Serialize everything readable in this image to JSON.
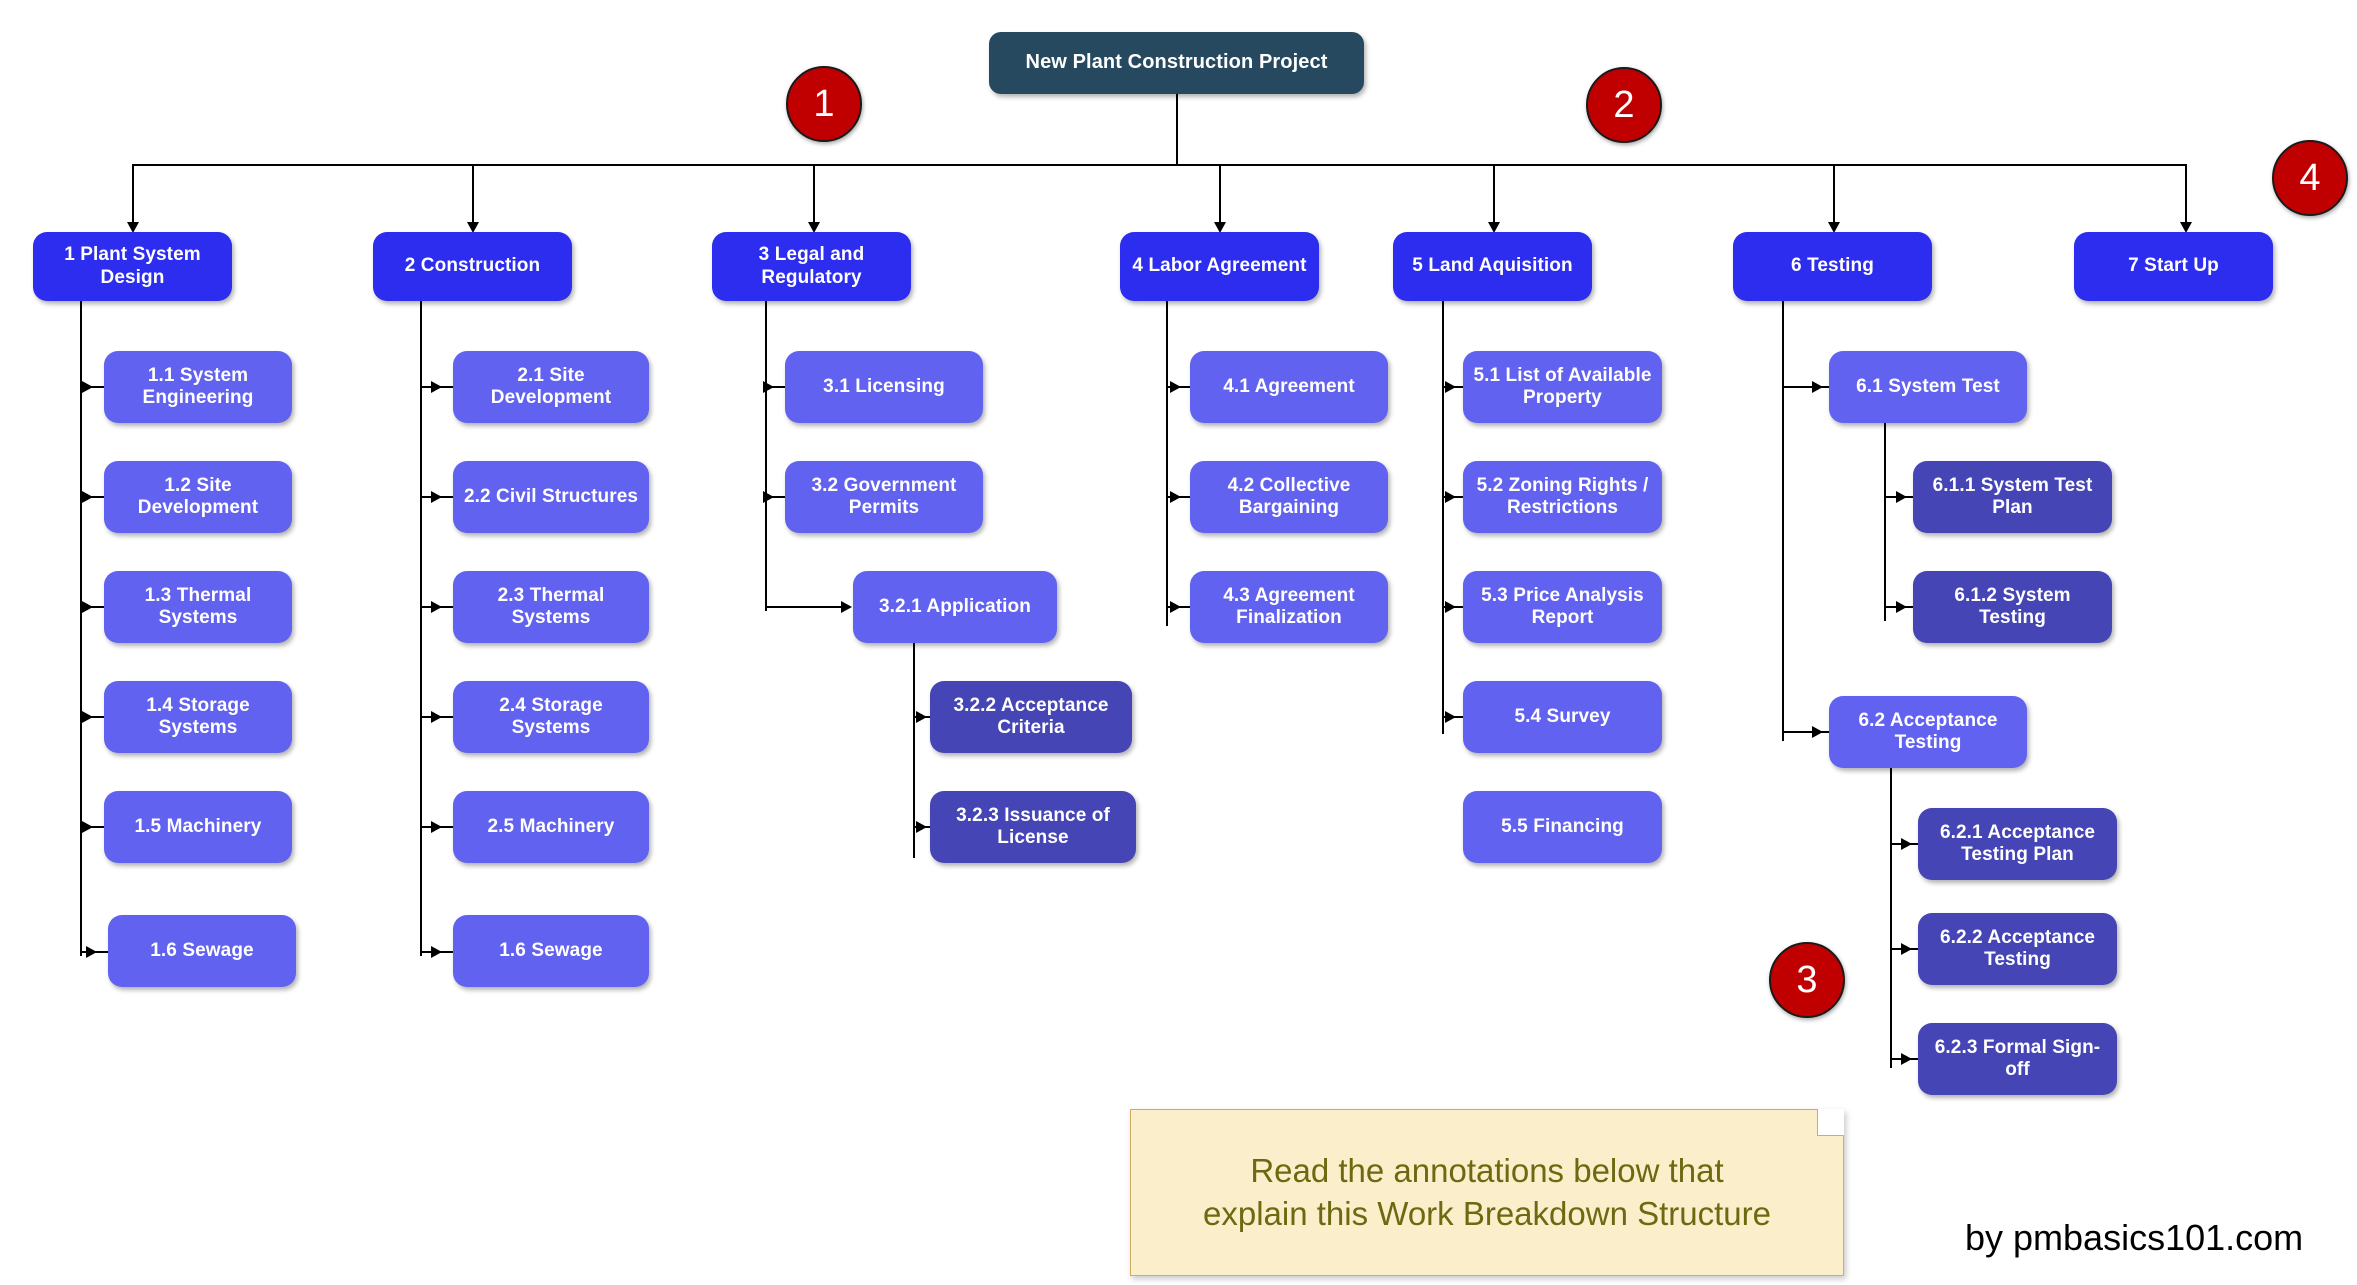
{
  "diagram": {
    "title": "Work Breakdown Structure",
    "root": {
      "label": "New Plant Construction Project"
    },
    "colors": {
      "root": "#26495f",
      "level1": "#2d2df0",
      "level2": "#6262f0",
      "level3": "#4545b5",
      "badge": "#c00000",
      "note_bg": "#fbeecb",
      "note_text": "#6b6a10",
      "connector": "#000000"
    },
    "columns": [
      {
        "id": "c1",
        "parent": {
          "label": "1  Plant System Design"
        },
        "children": [
          {
            "label": "1.1  System Engineering"
          },
          {
            "label": "1.2  Site Development"
          },
          {
            "label": "1.3  Thermal Systems"
          },
          {
            "label": "1.4  Storage Systems"
          },
          {
            "label": "1.5  Machinery"
          },
          {
            "label": "1.6  Sewage"
          }
        ]
      },
      {
        "id": "c2",
        "parent": {
          "label": "2  Construction"
        },
        "children": [
          {
            "label": "2.1  Site Development"
          },
          {
            "label": "2.2  Civil Structures"
          },
          {
            "label": "2.3  Thermal Systems"
          },
          {
            "label": "2.4  Storage Systems"
          },
          {
            "label": "2.5  Machinery"
          },
          {
            "label": "1.6 Sewage"
          }
        ]
      },
      {
        "id": "c3",
        "parent": {
          "label": "3  Legal and Regulatory"
        },
        "children": [
          {
            "label": "3.1  Licensing"
          },
          {
            "label": "3.2  Government Permits"
          },
          {
            "label": "3.2.1  Application"
          }
        ],
        "grandchildren": [
          {
            "label": "3.2.2  Acceptance Criteria"
          },
          {
            "label": "3.2.3  Issuance of License"
          }
        ]
      },
      {
        "id": "c4",
        "parent": {
          "label": "4  Labor Agreement"
        },
        "children": [
          {
            "label": "4.1  Agreement"
          },
          {
            "label": "4.2  Collective Bargaining"
          },
          {
            "label": "4.3  Agreement Finalization"
          }
        ]
      },
      {
        "id": "c5",
        "parent": {
          "label": "5  Land Aquisition"
        },
        "children": [
          {
            "label": "5.1  List of Available Property"
          },
          {
            "label": "5.2  Zoning Rights / Restrictions"
          },
          {
            "label": "5.3  Price Analysis Report"
          },
          {
            "label": "5.4  Survey"
          },
          {
            "label": "5.5  Financing"
          }
        ]
      },
      {
        "id": "c6",
        "parent": {
          "label": "6  Testing"
        },
        "children": [
          {
            "label": "6.1  System Test"
          },
          {
            "label": "6.2 Acceptance Testing"
          }
        ],
        "grandchildren_a": [
          {
            "label": "6.1.1 System Test Plan"
          },
          {
            "label": "6.1.2  System Testing"
          }
        ],
        "grandchildren_b": [
          {
            "label": "6.2.1 Acceptance Testing Plan"
          },
          {
            "label": "6.2.2 Acceptance Testing"
          },
          {
            "label": "6.2.3 Formal Sign-off"
          }
        ]
      },
      {
        "id": "c7",
        "parent": {
          "label": "7  Start Up"
        },
        "children": []
      }
    ],
    "badges": [
      {
        "label": "1"
      },
      {
        "label": "2"
      },
      {
        "label": "3"
      },
      {
        "label": "4"
      }
    ],
    "note": {
      "line1": "Read the annotations below that",
      "line2": "explain this Work Breakdown Structure"
    },
    "footer": {
      "credit": "by pmbasics101.com"
    }
  }
}
